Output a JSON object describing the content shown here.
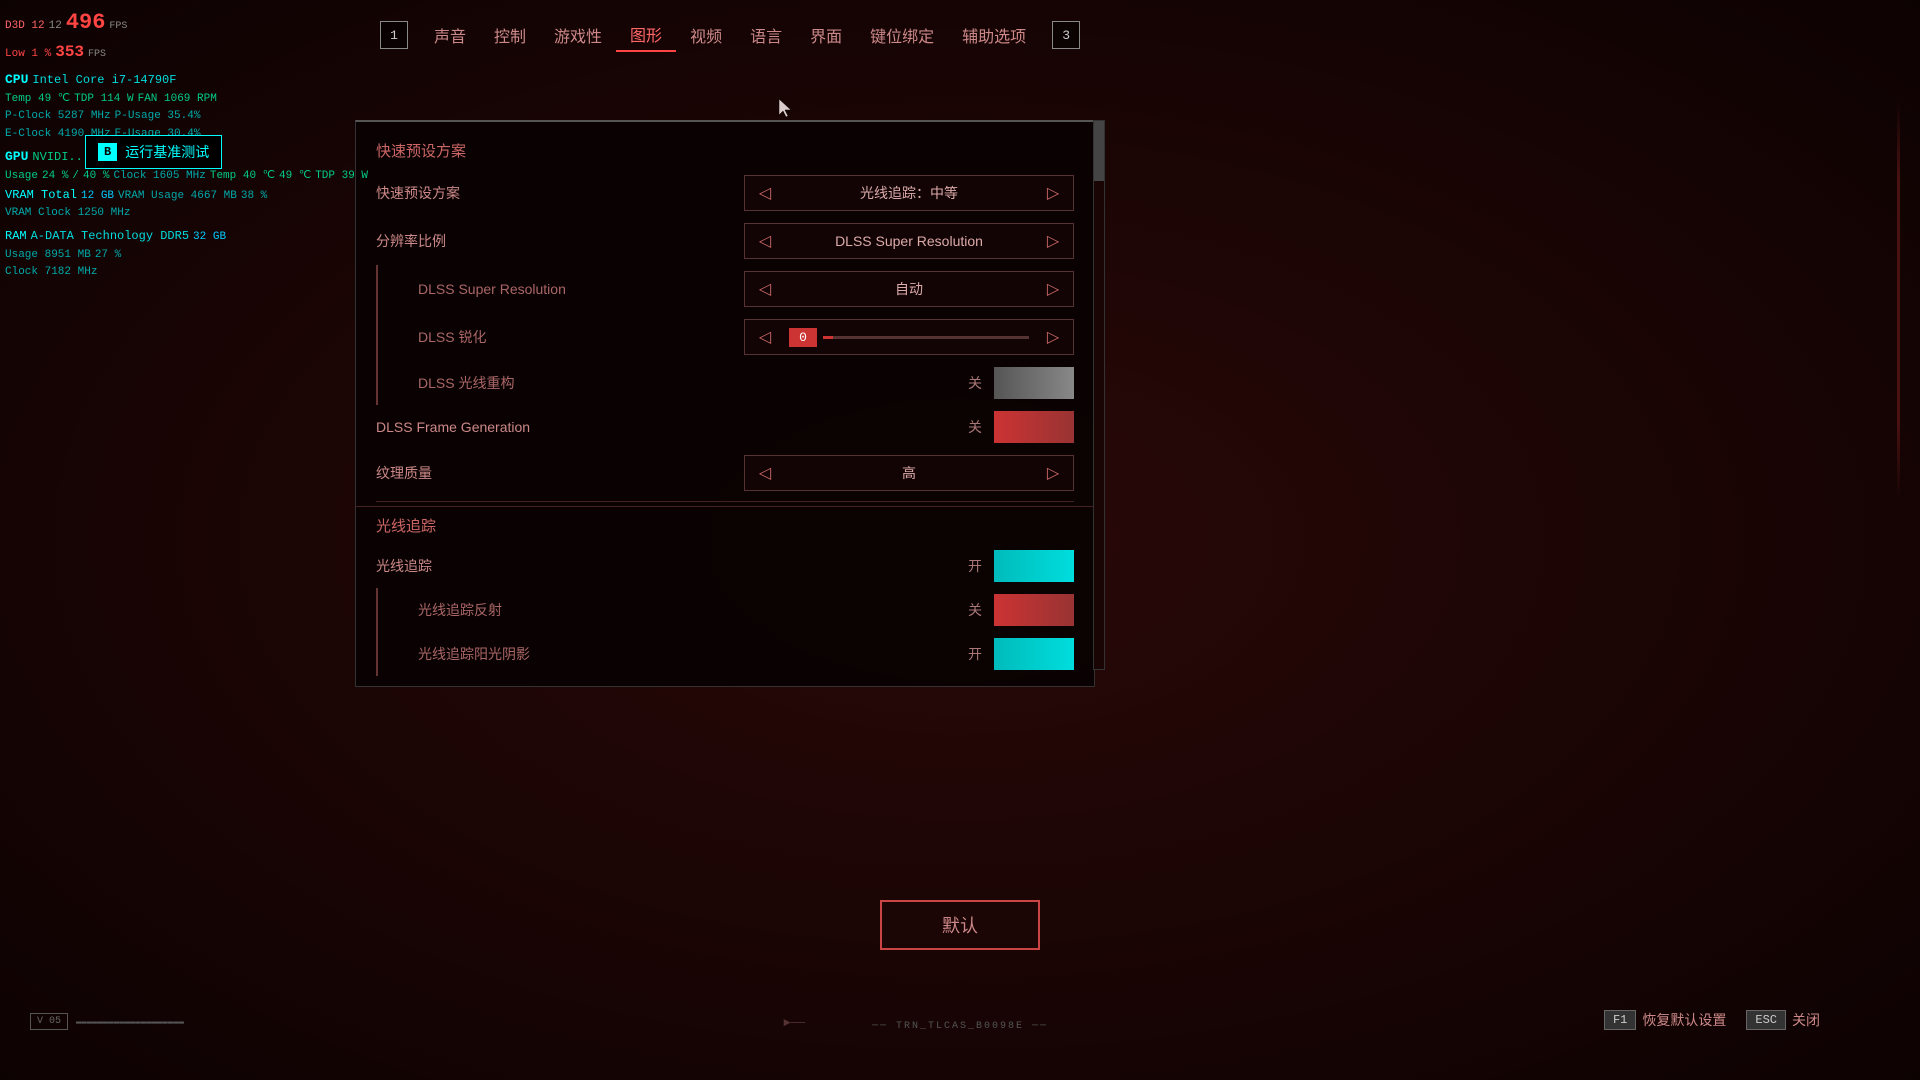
{
  "background": {
    "color": "#1a0505"
  },
  "hud": {
    "d3d": "D3D 12",
    "fps_big": "496",
    "fps_label": "FPS",
    "low_label": "Low 1 %",
    "low_fps": "353",
    "low_fps_label": "FPS",
    "cpu_label": "CPU",
    "cpu_name": "Intel Core i7-14790F",
    "temp": "Temp  49 ℃",
    "tdp": "TDP 114 W",
    "fan": "FAN 1069 RPM",
    "p_clock": "P-Clock  5287 MHz",
    "p_usage": "P-Usage  35.4%",
    "e_clock": "E-Clock  4190 MHz",
    "e_usage": "E-Usage  30.4%",
    "gpu_label": "GPU",
    "gpu_name": "NVIDI...",
    "usage_label": "Usage",
    "usage1": "24 %",
    "usage_sep": "/",
    "usage2": "40 %",
    "gpu_clock": "Clock 1605 MHz",
    "gpu_temp": "Temp 40 ℃",
    "gpu_temp2": "49 ℃",
    "gpu_tdp": "TDP   39 W",
    "vram_total": "VRAM Total",
    "vram_total_val": "12 GB",
    "vram_usage": "VRAM Usage 4667 MB",
    "vram_pct": "38 %",
    "vram_clock": "VRAM Clock  1250 MHz",
    "ram_label": "RAM",
    "ram_name": "A-DATA Technology DDR5",
    "ram_size": "32 GB",
    "ram_usage": "Usage  8951 MB",
    "ram_pct": "27 %",
    "ram_clock": "Clock  7182 MHz"
  },
  "benchmark": {
    "key": "B",
    "text": "运行基准测试"
  },
  "nav": {
    "left_badge": "1",
    "right_badge": "3",
    "items": [
      {
        "label": "声音",
        "active": false
      },
      {
        "label": "控制",
        "active": false
      },
      {
        "label": "游戏性",
        "active": false
      },
      {
        "label": "图形",
        "active": true
      },
      {
        "label": "视频",
        "active": false
      },
      {
        "label": "语言",
        "active": false
      },
      {
        "label": "界面",
        "active": false
      },
      {
        "label": "键位绑定",
        "active": false
      },
      {
        "label": "辅助选项",
        "active": false
      }
    ]
  },
  "settings": {
    "title": "快速预设方案",
    "quick_preset": {
      "label": "快速预设方案",
      "value": "光线追踪：中等"
    },
    "resolution_ratio": {
      "label": "分辨率比例",
      "value": "DLSS Super Resolution"
    },
    "dlss_super_res": {
      "label": "DLSS Super Resolution",
      "value": "自动"
    },
    "dlss_sharpness": {
      "label": "DLSS 锐化",
      "value": "0"
    },
    "dlss_ray_recon": {
      "label": "DLSS 光线重构",
      "status": "关"
    },
    "dlss_frame_gen": {
      "label": "DLSS Frame Generation",
      "status": "关"
    },
    "texture_quality": {
      "label": "纹理质量",
      "value": "高"
    },
    "ray_tracing_section": "光线追踪",
    "ray_tracing": {
      "label": "光线追踪",
      "status": "开"
    },
    "ray_tracing_reflections": {
      "label": "光线追踪反射",
      "status": "关"
    },
    "ray_tracing_sun_shadows": {
      "label": "光线追踪阳光阴影",
      "status": "开"
    }
  },
  "buttons": {
    "default": "默认",
    "restore_key": "F1",
    "restore_label": "恢复默认设置",
    "close_key": "ESC",
    "close_label": "关闭"
  },
  "version": {
    "badge": "V\n05",
    "text": "▬▬▬▬▬▬▬▬▬▬▬▬▬▬▬▬▬▬▬▬"
  },
  "watermark": "── TRN_TLCAS_B0098E ──"
}
